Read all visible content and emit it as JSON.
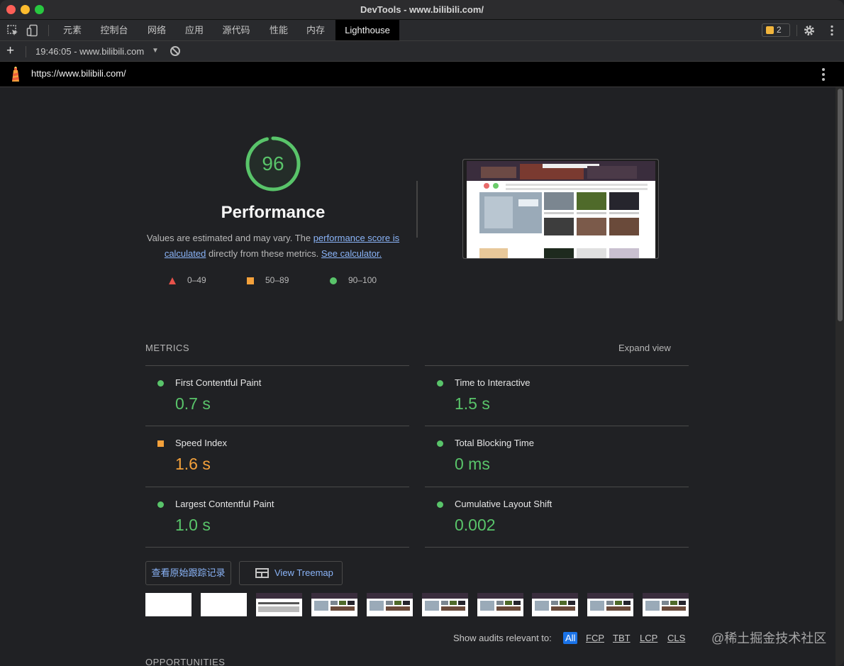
{
  "window": {
    "title": "DevTools - www.bilibili.com/"
  },
  "tabs": [
    "元素",
    "控制台",
    "网络",
    "应用",
    "源代码",
    "性能",
    "内存",
    "Lighthouse"
  ],
  "issues": {
    "count": "2"
  },
  "toolbar": {
    "plus": "+",
    "report": "19:46:05 - www.bilibili.com",
    "caret": "▼"
  },
  "urlbar": {
    "url": "https://www.bilibili.com/"
  },
  "performance": {
    "score": "96",
    "title": "Performance",
    "desc_pre": "Values are estimated and may vary. The ",
    "desc_link1": "performance score is calculated",
    "desc_mid": " directly from these metrics. ",
    "desc_link2": "See calculator.",
    "legend": [
      "0–49",
      "50–89",
      "90–100"
    ],
    "colors": {
      "pass": "#59c46a",
      "average": "#f4a13b",
      "fail": "#e8524a"
    }
  },
  "metrics": {
    "title": "METRICS",
    "expand": "Expand view",
    "items": [
      {
        "label": "First Contentful Paint",
        "value": "0.7 s",
        "rating": "pass"
      },
      {
        "label": "Time to Interactive",
        "value": "1.5 s",
        "rating": "pass"
      },
      {
        "label": "Speed Index",
        "value": "1.6 s",
        "rating": "average"
      },
      {
        "label": "Total Blocking Time",
        "value": "0 ms",
        "rating": "pass"
      },
      {
        "label": "Largest Contentful Paint",
        "value": "1.0 s",
        "rating": "pass"
      },
      {
        "label": "Cumulative Layout Shift",
        "value": "0.002",
        "rating": "pass"
      }
    ]
  },
  "buttons": {
    "trace": "查看原始跟踪记录",
    "treemap": "View Treemap"
  },
  "audits": {
    "label": "Show audits relevant to:",
    "filters": [
      "All",
      "FCP",
      "TBT",
      "LCP",
      "CLS"
    ]
  },
  "watermark": "@稀土掘金技术社区",
  "opportunities": {
    "title": "OPPORTUNITIES"
  }
}
